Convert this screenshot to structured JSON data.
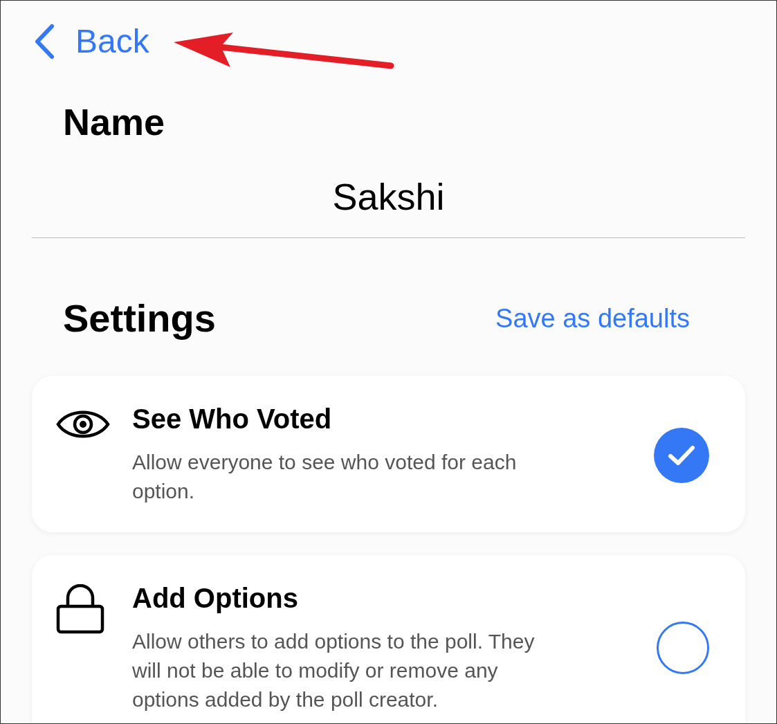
{
  "nav": {
    "back_label": "Back"
  },
  "name_section": {
    "heading": "Name",
    "value": "Sakshi"
  },
  "settings_section": {
    "heading": "Settings",
    "action": "Save as defaults"
  },
  "settings": [
    {
      "kind": "eye",
      "title": "See Who Voted",
      "description": "Allow everyone to see who voted for each option.",
      "checked": true
    },
    {
      "kind": "lock",
      "title": "Add Options",
      "description": "Allow others to add options to the poll. They will not be able to modify or remove any options added by the poll creator.",
      "checked": false
    }
  ]
}
